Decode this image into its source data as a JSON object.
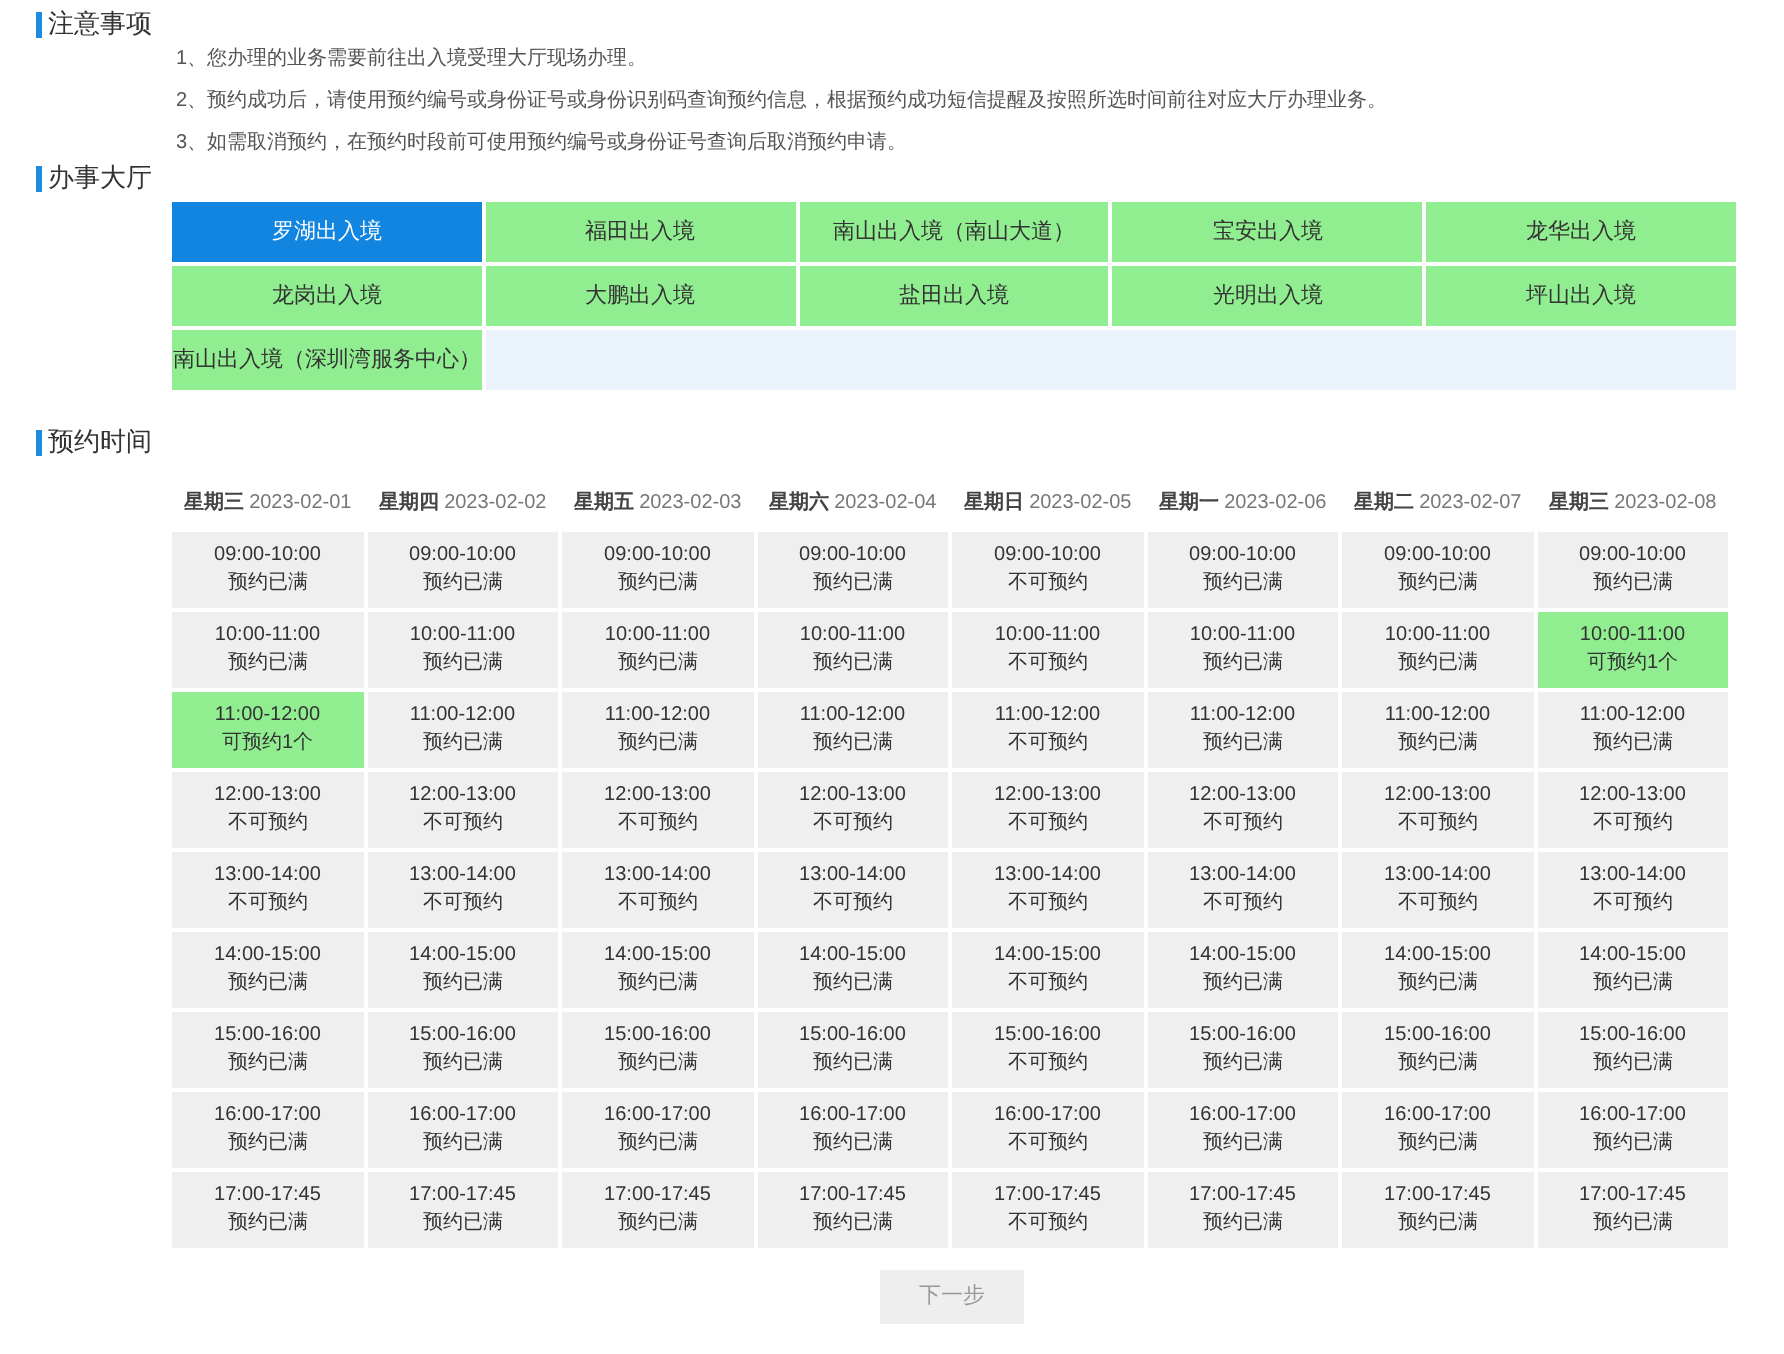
{
  "notice": {
    "title": "注意事项",
    "items": [
      "1、您办理的业务需要前往出入境受理大厅现场办理。",
      "2、预约成功后，请使用预约编号或身份证号或身份识别码查询预约信息，根据预约成功短信提醒及按照所选时间前往对应大厅办理业务。",
      "3、如需取消预约，在预约时段前可使用预约编号或身份证号查询后取消预约申请。"
    ]
  },
  "halls": {
    "title": "办事大厅",
    "items": [
      {
        "label": "罗湖出入境",
        "selected": true
      },
      {
        "label": "福田出入境",
        "selected": false
      },
      {
        "label": "南山出入境（南山大道）",
        "selected": false
      },
      {
        "label": "宝安出入境",
        "selected": false
      },
      {
        "label": "龙华出入境",
        "selected": false
      },
      {
        "label": "龙岗出入境",
        "selected": false
      },
      {
        "label": "大鹏出入境",
        "selected": false
      },
      {
        "label": "盐田出入境",
        "selected": false
      },
      {
        "label": "光明出入境",
        "selected": false
      },
      {
        "label": "坪山出入境",
        "selected": false
      },
      {
        "label": "南山出入境（深圳湾服务中心）",
        "selected": false
      }
    ]
  },
  "schedule": {
    "title": "预约时间",
    "days": [
      {
        "weekday": "星期三",
        "date": "2023-02-01",
        "slots": [
          {
            "time": "09:00-10:00",
            "status": "预约已满",
            "kind": "full"
          },
          {
            "time": "10:00-11:00",
            "status": "预约已满",
            "kind": "full"
          },
          {
            "time": "11:00-12:00",
            "status": "可预约1个",
            "kind": "open"
          },
          {
            "time": "12:00-13:00",
            "status": "不可预约",
            "kind": "closed"
          },
          {
            "time": "13:00-14:00",
            "status": "不可预约",
            "kind": "closed"
          },
          {
            "time": "14:00-15:00",
            "status": "预约已满",
            "kind": "full"
          },
          {
            "time": "15:00-16:00",
            "status": "预约已满",
            "kind": "full"
          },
          {
            "time": "16:00-17:00",
            "status": "预约已满",
            "kind": "full"
          },
          {
            "time": "17:00-17:45",
            "status": "预约已满",
            "kind": "full"
          }
        ]
      },
      {
        "weekday": "星期四",
        "date": "2023-02-02",
        "slots": [
          {
            "time": "09:00-10:00",
            "status": "预约已满",
            "kind": "full"
          },
          {
            "time": "10:00-11:00",
            "status": "预约已满",
            "kind": "full"
          },
          {
            "time": "11:00-12:00",
            "status": "预约已满",
            "kind": "full"
          },
          {
            "time": "12:00-13:00",
            "status": "不可预约",
            "kind": "closed"
          },
          {
            "time": "13:00-14:00",
            "status": "不可预约",
            "kind": "closed"
          },
          {
            "time": "14:00-15:00",
            "status": "预约已满",
            "kind": "full"
          },
          {
            "time": "15:00-16:00",
            "status": "预约已满",
            "kind": "full"
          },
          {
            "time": "16:00-17:00",
            "status": "预约已满",
            "kind": "full"
          },
          {
            "time": "17:00-17:45",
            "status": "预约已满",
            "kind": "full"
          }
        ]
      },
      {
        "weekday": "星期五",
        "date": "2023-02-03",
        "slots": [
          {
            "time": "09:00-10:00",
            "status": "预约已满",
            "kind": "full"
          },
          {
            "time": "10:00-11:00",
            "status": "预约已满",
            "kind": "full"
          },
          {
            "time": "11:00-12:00",
            "status": "预约已满",
            "kind": "full"
          },
          {
            "time": "12:00-13:00",
            "status": "不可预约",
            "kind": "closed"
          },
          {
            "time": "13:00-14:00",
            "status": "不可预约",
            "kind": "closed"
          },
          {
            "time": "14:00-15:00",
            "status": "预约已满",
            "kind": "full"
          },
          {
            "time": "15:00-16:00",
            "status": "预约已满",
            "kind": "full"
          },
          {
            "time": "16:00-17:00",
            "status": "预约已满",
            "kind": "full"
          },
          {
            "time": "17:00-17:45",
            "status": "预约已满",
            "kind": "full"
          }
        ]
      },
      {
        "weekday": "星期六",
        "date": "2023-02-04",
        "slots": [
          {
            "time": "09:00-10:00",
            "status": "预约已满",
            "kind": "full"
          },
          {
            "time": "10:00-11:00",
            "status": "预约已满",
            "kind": "full"
          },
          {
            "time": "11:00-12:00",
            "status": "预约已满",
            "kind": "full"
          },
          {
            "time": "12:00-13:00",
            "status": "不可预约",
            "kind": "closed"
          },
          {
            "time": "13:00-14:00",
            "status": "不可预约",
            "kind": "closed"
          },
          {
            "time": "14:00-15:00",
            "status": "预约已满",
            "kind": "full"
          },
          {
            "time": "15:00-16:00",
            "status": "预约已满",
            "kind": "full"
          },
          {
            "time": "16:00-17:00",
            "status": "预约已满",
            "kind": "full"
          },
          {
            "time": "17:00-17:45",
            "status": "预约已满",
            "kind": "full"
          }
        ]
      },
      {
        "weekday": "星期日",
        "date": "2023-02-05",
        "slots": [
          {
            "time": "09:00-10:00",
            "status": "不可预约",
            "kind": "closed"
          },
          {
            "time": "10:00-11:00",
            "status": "不可预约",
            "kind": "closed"
          },
          {
            "time": "11:00-12:00",
            "status": "不可预约",
            "kind": "closed"
          },
          {
            "time": "12:00-13:00",
            "status": "不可预约",
            "kind": "closed"
          },
          {
            "time": "13:00-14:00",
            "status": "不可预约",
            "kind": "closed"
          },
          {
            "time": "14:00-15:00",
            "status": "不可预约",
            "kind": "closed"
          },
          {
            "time": "15:00-16:00",
            "status": "不可预约",
            "kind": "closed"
          },
          {
            "time": "16:00-17:00",
            "status": "不可预约",
            "kind": "closed"
          },
          {
            "time": "17:00-17:45",
            "status": "不可预约",
            "kind": "closed"
          }
        ]
      },
      {
        "weekday": "星期一",
        "date": "2023-02-06",
        "slots": [
          {
            "time": "09:00-10:00",
            "status": "预约已满",
            "kind": "full"
          },
          {
            "time": "10:00-11:00",
            "status": "预约已满",
            "kind": "full"
          },
          {
            "time": "11:00-12:00",
            "status": "预约已满",
            "kind": "full"
          },
          {
            "time": "12:00-13:00",
            "status": "不可预约",
            "kind": "closed"
          },
          {
            "time": "13:00-14:00",
            "status": "不可预约",
            "kind": "closed"
          },
          {
            "time": "14:00-15:00",
            "status": "预约已满",
            "kind": "full"
          },
          {
            "time": "15:00-16:00",
            "status": "预约已满",
            "kind": "full"
          },
          {
            "time": "16:00-17:00",
            "status": "预约已满",
            "kind": "full"
          },
          {
            "time": "17:00-17:45",
            "status": "预约已满",
            "kind": "full"
          }
        ]
      },
      {
        "weekday": "星期二",
        "date": "2023-02-07",
        "slots": [
          {
            "time": "09:00-10:00",
            "status": "预约已满",
            "kind": "full"
          },
          {
            "time": "10:00-11:00",
            "status": "预约已满",
            "kind": "full"
          },
          {
            "time": "11:00-12:00",
            "status": "预约已满",
            "kind": "full"
          },
          {
            "time": "12:00-13:00",
            "status": "不可预约",
            "kind": "closed"
          },
          {
            "time": "13:00-14:00",
            "status": "不可预约",
            "kind": "closed"
          },
          {
            "time": "14:00-15:00",
            "status": "预约已满",
            "kind": "full"
          },
          {
            "time": "15:00-16:00",
            "status": "预约已满",
            "kind": "full"
          },
          {
            "time": "16:00-17:00",
            "status": "预约已满",
            "kind": "full"
          },
          {
            "time": "17:00-17:45",
            "status": "预约已满",
            "kind": "full"
          }
        ]
      },
      {
        "weekday": "星期三",
        "date": "2023-02-08",
        "slots": [
          {
            "time": "09:00-10:00",
            "status": "预约已满",
            "kind": "full"
          },
          {
            "time": "10:00-11:00",
            "status": "可预约1个",
            "kind": "open"
          },
          {
            "time": "11:00-12:00",
            "status": "预约已满",
            "kind": "full"
          },
          {
            "time": "12:00-13:00",
            "status": "不可预约",
            "kind": "closed"
          },
          {
            "time": "13:00-14:00",
            "status": "不可预约",
            "kind": "closed"
          },
          {
            "time": "14:00-15:00",
            "status": "预约已满",
            "kind": "full"
          },
          {
            "time": "15:00-16:00",
            "status": "预约已满",
            "kind": "full"
          },
          {
            "time": "16:00-17:00",
            "status": "预约已满",
            "kind": "full"
          },
          {
            "time": "17:00-17:45",
            "status": "预约已满",
            "kind": "full"
          }
        ]
      }
    ]
  },
  "next_button": {
    "label": "下一步",
    "disabled": true
  }
}
